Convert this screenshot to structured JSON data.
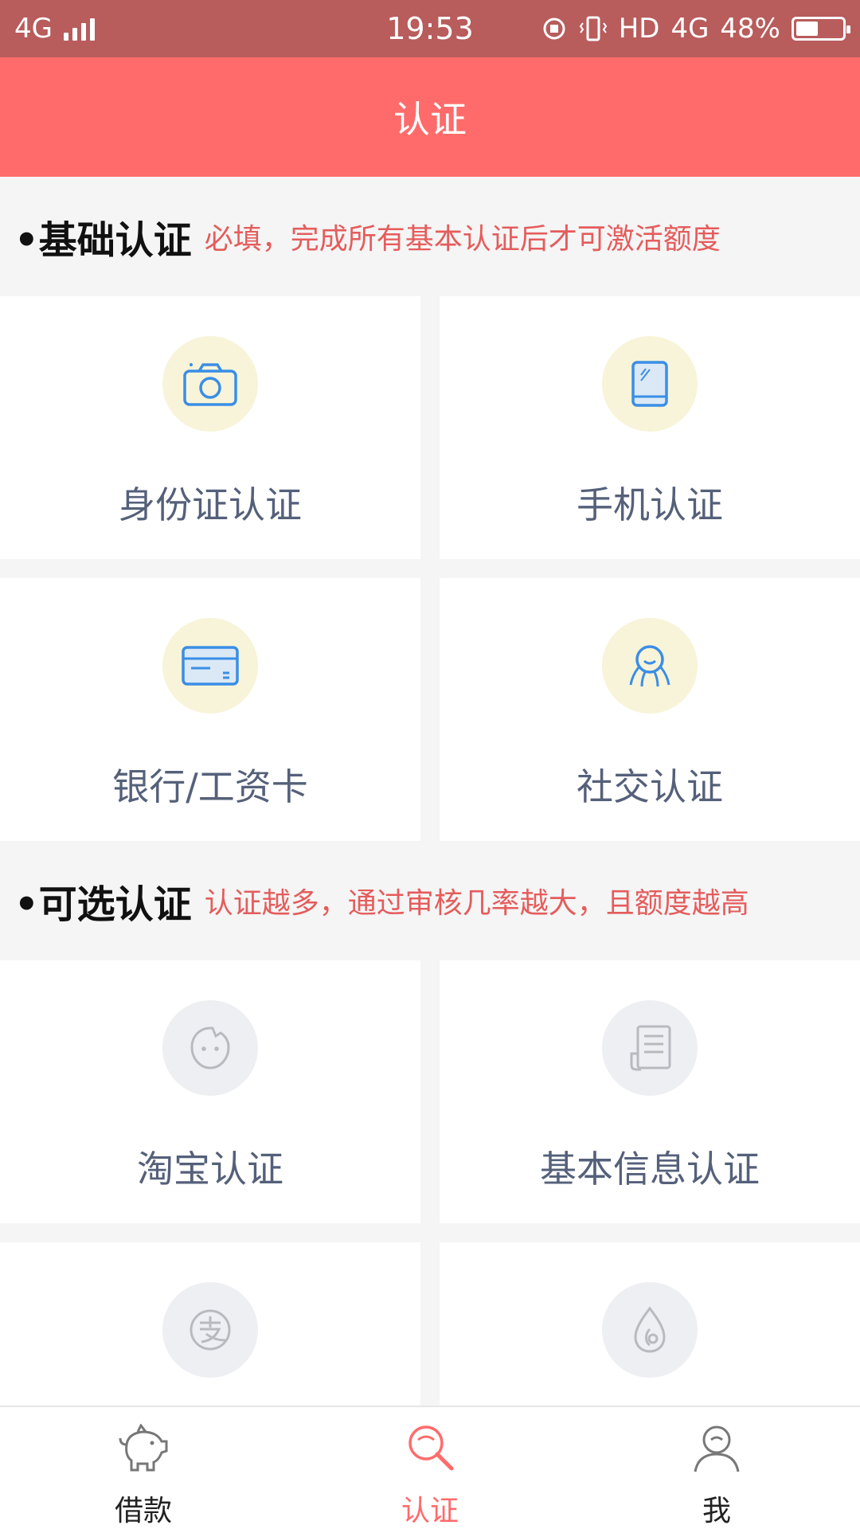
{
  "status_bar": {
    "network": "4G",
    "time": "19:53",
    "hd": "HD",
    "network_right": "4G",
    "battery": "48%",
    "battery_level": 0.48
  },
  "header": {
    "title": "认证"
  },
  "basic_section": {
    "title": "•基础认证",
    "note": "必填，完成所有基本认证后才可激活额度",
    "items": [
      {
        "label": "身份证认证",
        "icon": "camera-icon"
      },
      {
        "label": "手机认证",
        "icon": "tablet-icon"
      },
      {
        "label": "银行/工资卡",
        "icon": "bank-card-icon"
      },
      {
        "label": "社交认证",
        "icon": "social-icon"
      }
    ]
  },
  "optional_section": {
    "title": "•可选认证",
    "note": "认证越多，通过审核几率越大，且额度越高",
    "items": [
      {
        "label": "淘宝认证",
        "icon": "taobao-icon"
      },
      {
        "label": "基本信息认证",
        "icon": "document-icon"
      },
      {
        "label": "",
        "icon": "alipay-icon"
      },
      {
        "label": "",
        "icon": "drop-icon"
      }
    ]
  },
  "bottom_nav": {
    "items": [
      {
        "label": "借款",
        "icon": "piggy-bank-icon"
      },
      {
        "label": "认证",
        "icon": "search-icon"
      },
      {
        "label": "我",
        "icon": "user-icon"
      }
    ],
    "active_index": 1
  },
  "colors": {
    "primary": "#ff6b6b",
    "status_bar": "#b85c5c",
    "icon_blue": "#3a8ee6",
    "note_red": "#e55c5c"
  }
}
